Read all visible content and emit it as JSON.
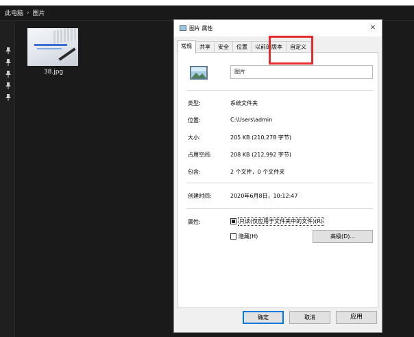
{
  "breadcrumb": {
    "parent": "此电脑",
    "separator": "›",
    "current": "图片"
  },
  "files": [
    {
      "name": "38.jpg"
    }
  ],
  "sidebar": {
    "pins": [
      "pin-icon",
      "pin-icon",
      "pin-icon",
      "pin-icon",
      "pin-icon"
    ]
  },
  "dialog": {
    "title": "图片 属性",
    "close_label": "×",
    "tabs": [
      "常规",
      "共享",
      "安全",
      "位置",
      "以前的版本",
      "自定义"
    ],
    "active_tab": "常规",
    "folder_name": "图片",
    "properties": [
      {
        "label": "类型:",
        "value": "系统文件夹"
      },
      {
        "label": "位置:",
        "value": "C:\\Users\\admin"
      },
      {
        "label": "大小:",
        "value": "205 KB (210,278 字节)"
      },
      {
        "label": "占用空间:",
        "value": "208 KB (212,992 字节)"
      },
      {
        "label": "包含:",
        "value": "2 个文件，0 个文件夹"
      }
    ],
    "created": {
      "label": "创建时间:",
      "value": "2020年6月8日，10:12:47"
    },
    "attributes": {
      "label": "属性:",
      "readonly": "只读(仅应用于文件夹中的文件)(R)",
      "hidden": "隐藏(H)",
      "advanced": "高级(D)..."
    },
    "buttons": {
      "ok": "确定",
      "cancel": "取消",
      "apply": "应用"
    }
  },
  "colors": {
    "highlight": "#e52b2b",
    "explorer_bg": "#1a1a1a",
    "dialog_bg": "#f0f0f0",
    "primary_border": "#0078d7"
  }
}
